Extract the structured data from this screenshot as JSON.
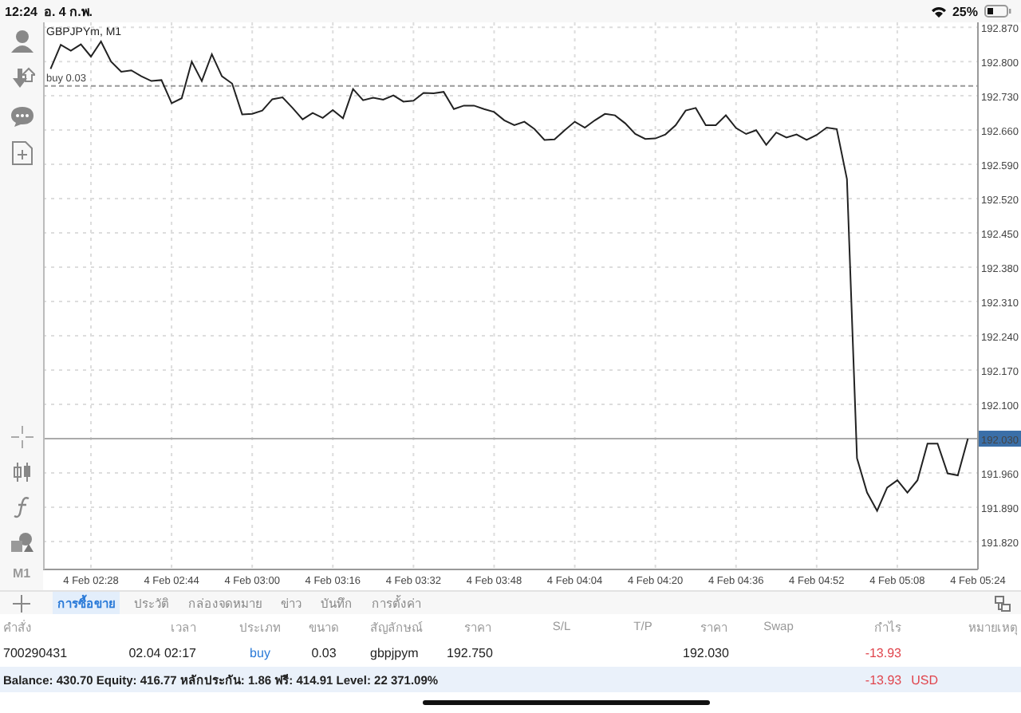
{
  "status_bar": {
    "time": "12:24",
    "date": "อ. 4 ก.พ.",
    "battery": "25%"
  },
  "toolbar": {
    "timeframe": "M1"
  },
  "chart": {
    "chart_data": {
      "type": "line",
      "title": "GBPJPYm, M1",
      "grid": true,
      "ref_lines": [
        {
          "axis": "y",
          "value": 192.75,
          "label": "buy 0.03"
        },
        {
          "axis": "y",
          "value": 192.03,
          "label": "192.030"
        }
      ],
      "categories": [
        null,
        null,
        null,
        null,
        "4 Feb 02:28",
        null,
        null,
        null,
        null,
        null,
        null,
        null,
        "4 Feb 02:44",
        null,
        null,
        null,
        null,
        null,
        null,
        null,
        "4 Feb 03:00",
        null,
        null,
        null,
        null,
        null,
        null,
        null,
        "4 Feb 03:16",
        null,
        null,
        null,
        null,
        null,
        null,
        null,
        "4 Feb 03:32",
        null,
        null,
        null,
        null,
        null,
        null,
        null,
        "4 Feb 03:48",
        null,
        null,
        null,
        null,
        null,
        null,
        null,
        "4 Feb 04:04",
        null,
        null,
        null,
        null,
        null,
        null,
        null,
        "4 Feb 04:20",
        null,
        null,
        null,
        null,
        null,
        null,
        null,
        "4 Feb 04:36",
        null,
        null,
        null,
        null,
        null,
        null,
        null,
        "4 Feb 04:52",
        null,
        null,
        null,
        null,
        null,
        null,
        null,
        "4 Feb 05:08",
        null,
        null,
        null,
        null,
        null,
        null,
        null,
        "4 Feb 05:24"
      ],
      "series": [
        {
          "color": "#222222",
          "values": [
            192.785,
            192.834,
            192.822,
            192.835,
            192.81,
            192.841,
            192.8,
            192.779,
            192.782,
            192.77,
            192.76,
            192.762,
            192.715,
            192.725,
            192.8,
            192.76,
            192.815,
            192.77,
            192.755,
            192.692,
            192.693,
            192.7,
            192.723,
            192.727,
            192.705,
            192.682,
            192.695,
            192.685,
            192.701,
            192.684,
            192.744,
            192.721,
            192.726,
            192.722,
            192.731,
            192.718,
            192.72,
            192.736,
            192.735,
            192.738,
            192.703,
            192.71,
            192.71,
            192.703,
            192.697,
            192.68,
            192.67,
            192.677,
            192.662,
            192.64,
            192.641,
            192.66,
            192.677,
            192.665,
            192.68,
            192.693,
            192.69,
            192.674,
            192.652,
            192.642,
            192.643,
            192.651,
            192.67,
            192.7,
            192.705,
            192.67,
            192.67,
            192.69,
            192.664,
            192.652,
            192.66,
            192.63,
            192.655,
            192.645,
            192.651,
            192.64,
            192.65,
            192.665,
            192.662,
            192.56,
            191.99,
            191.92,
            191.883,
            191.93,
            191.945,
            191.92,
            191.945,
            192.02,
            192.02,
            191.959,
            191.955,
            192.03,
            null
          ]
        }
      ],
      "ylim": [
        191.763,
        192.88
      ],
      "yticks": [
        {
          "value": 192.87,
          "label": "192.870"
        },
        {
          "value": 192.8,
          "label": "192.800"
        },
        {
          "value": 192.73,
          "label": "192.730"
        },
        {
          "value": 192.66,
          "label": "192.660"
        },
        {
          "value": 192.59,
          "label": "192.590"
        },
        {
          "value": 192.52,
          "label": "192.520"
        },
        {
          "value": 192.45,
          "label": "192.450"
        },
        {
          "value": 192.38,
          "label": "192.380"
        },
        {
          "value": 192.31,
          "label": "192.310"
        },
        {
          "value": 192.24,
          "label": "192.240"
        },
        {
          "value": 192.17,
          "label": "192.170"
        },
        {
          "value": 192.1,
          "label": "192.100"
        },
        {
          "value": 191.96,
          "label": "191.960"
        },
        {
          "value": 191.89,
          "label": "191.890"
        },
        {
          "value": 191.82,
          "label": "191.820"
        }
      ]
    }
  },
  "tabs": [
    {
      "label": "การซื้อขาย",
      "selected": true
    },
    {
      "label": "ประวัติ",
      "selected": false
    },
    {
      "label": "กล่องจดหมาย",
      "selected": false
    },
    {
      "label": "ข่าว",
      "selected": false
    },
    {
      "label": "บันทึก",
      "selected": false
    },
    {
      "label": "การตั้งค่า",
      "selected": false
    }
  ],
  "table": {
    "columns": [
      "คำสั่ง",
      "เวลา",
      "ประเภท",
      "ขนาด",
      "สัญลักษณ์",
      "ราคา",
      "S/L",
      "T/P",
      "ราคา",
      "Swap",
      "กำไร",
      "หมายเหตุ"
    ],
    "rows": [
      {
        "order": "700290431",
        "time": "02.04 02:17",
        "type": "buy",
        "volume": "0.03",
        "symbol": "gbpjpym",
        "open_price": "192.750",
        "price": "192.030",
        "profit": "-13.93"
      }
    ]
  },
  "summary": {
    "text": "Balance: 430.70 Equity: 416.77 หลักประกัน: 1.86 ฟรี: 414.91 Level: 22 371.09%",
    "profit": "-13.93",
    "currency": "USD"
  }
}
